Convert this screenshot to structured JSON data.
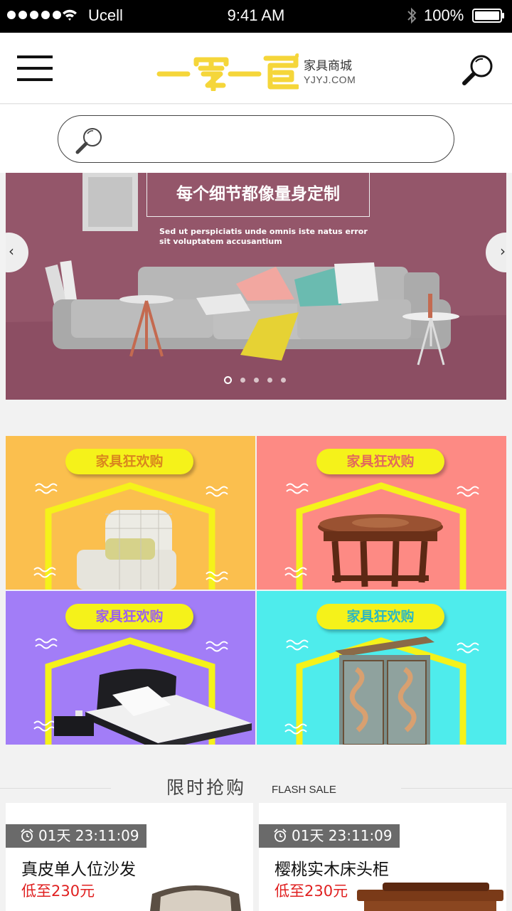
{
  "status_bar": {
    "carrier": "Ucell",
    "time": "9:41 AM",
    "battery": "100%"
  },
  "header": {
    "logo_cn": "家具商城",
    "logo_en": "YJYJ.COM",
    "menu_icon": "hamburger-menu-icon",
    "search_icon": "magnifier-icon"
  },
  "search": {
    "placeholder": ""
  },
  "banner": {
    "title": "每个细节都像量身定制",
    "subtitle": "Sed ut perspiciatis unde omnis iste natus error sit voluptatem accusantium",
    "prev_label": "‹",
    "next_label": "›",
    "slide_count": 5,
    "active_slide": 1
  },
  "promos": [
    {
      "label": "家具狂欢购",
      "bg": "#fbbf4e",
      "label_color": "#d9861e",
      "item": "armchair"
    },
    {
      "label": "家具狂欢购",
      "bg": "#fd8a84",
      "label_color": "#e2695c",
      "item": "round-table"
    },
    {
      "label": "家具狂欢购",
      "bg": "#a27df7",
      "label_color": "#9b5ef0",
      "item": "bed"
    },
    {
      "label": "家具狂欢购",
      "bg": "#4eecec",
      "label_color": "#2ab7c4",
      "item": "wardrobe"
    }
  ],
  "flash_sale": {
    "title_cn": "限时抢购",
    "title_en": "FLASH SALE",
    "items": [
      {
        "timer": "01天 23:11:09",
        "name": "真皮单人位沙发",
        "price": "低至230元"
      },
      {
        "timer": "01天 23:11:09",
        "name": "樱桃实木床头柜",
        "price": "低至230元"
      }
    ]
  },
  "colors": {
    "accent_yellow": "#f5d63a",
    "price_red": "#e02020",
    "banner_bg": "#94566a"
  }
}
